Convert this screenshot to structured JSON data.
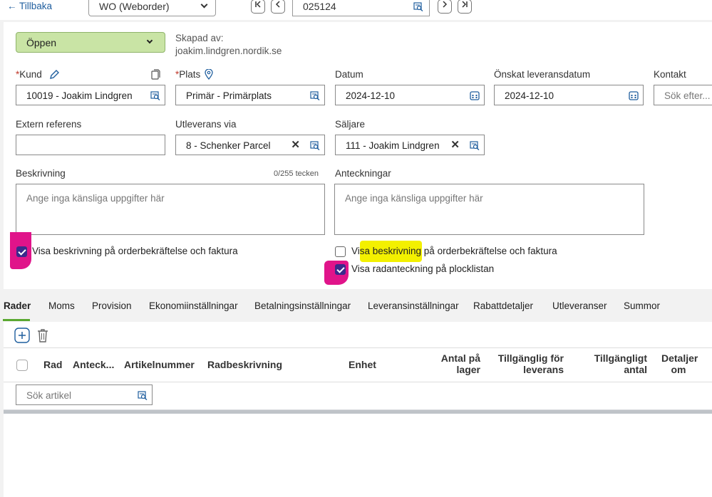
{
  "topbar": {
    "back_label": "← Tillbaka",
    "order_type": "WO (Weborder)",
    "order_number": "025124",
    "nav_first": "|<",
    "nav_prev": "<",
    "nav_next": ">",
    "nav_last": ">|"
  },
  "header": {
    "status": "Öppen",
    "created_by_label": "Skapad av:",
    "created_by_value": "joakim.lindgren.nordik.se"
  },
  "fields": {
    "kund_label": "Kund",
    "kund_value": "10019 - Joakim Lindgren",
    "plats_label": "Plats",
    "plats_value": "Primär - Primärplats",
    "datum_label": "Datum",
    "datum_value": "2024-12-10",
    "leveransdatum_label": "Önskat leveransdatum",
    "leveransdatum_value": "2024-12-10",
    "kontakt_label": "Kontakt",
    "kontakt_placeholder": "Sök efter...",
    "extern_label": "Extern referens",
    "extern_value": "",
    "utleverans_label": "Utleverans via",
    "utleverans_value": "8 - Schenker Parcel",
    "saljare_label": "Säljare",
    "saljare_value": "111 - Joakim Lindgren",
    "beskrivning_label": "Beskrivning",
    "beskrivning_counter": "0/255 tecken",
    "beskrivning_placeholder": "Ange inga känsliga uppgifter här",
    "anteckningar_label": "Anteckningar",
    "anteckningar_placeholder": "Ange inga känsliga uppgifter här",
    "required_mark": "*"
  },
  "checkboxes": {
    "cb1_label": "Visa beskrivning på orderbekräftelse och faktura",
    "cb2_label": "Visa beskrivning på orderbekräftelse och faktura",
    "cb3_label": "Visa radanteckning på plocklistan",
    "cb1_checked": true,
    "cb2_checked": false,
    "cb3_checked": true
  },
  "tabs": [
    "Rader",
    "Moms",
    "Provision",
    "Ekonomiinställningar",
    "Betalningsinställningar",
    "Leveransinställningar",
    "Rabattdetaljer",
    "Utleveranser",
    "Summor"
  ],
  "grid": {
    "columns": {
      "rad": "Rad",
      "anteck": "Anteck...",
      "artikelnummer": "Artikelnummer",
      "radbeskrivning": "Radbeskrivning",
      "enhet": "Enhet",
      "antal_1": "Antal på",
      "antal_2": "lager",
      "tillg_lev_1": "Tillgänglig för",
      "tillg_lev_2": "leverans",
      "tillg_antal_1": "Tillgängligt",
      "tillg_antal_2": "antal",
      "detaljer_1": "Detaljer",
      "detaljer_2": "om"
    },
    "search_placeholder": "Sök artikel"
  },
  "colors": {
    "status_bg": "#c9e4a5",
    "accent": "#1f5e9e",
    "active_tab": "#5aa830",
    "checkbox_checked": "#3b2a8c",
    "highlight_yellow": "#f3f000",
    "highlight_pink": "#e0148a"
  }
}
